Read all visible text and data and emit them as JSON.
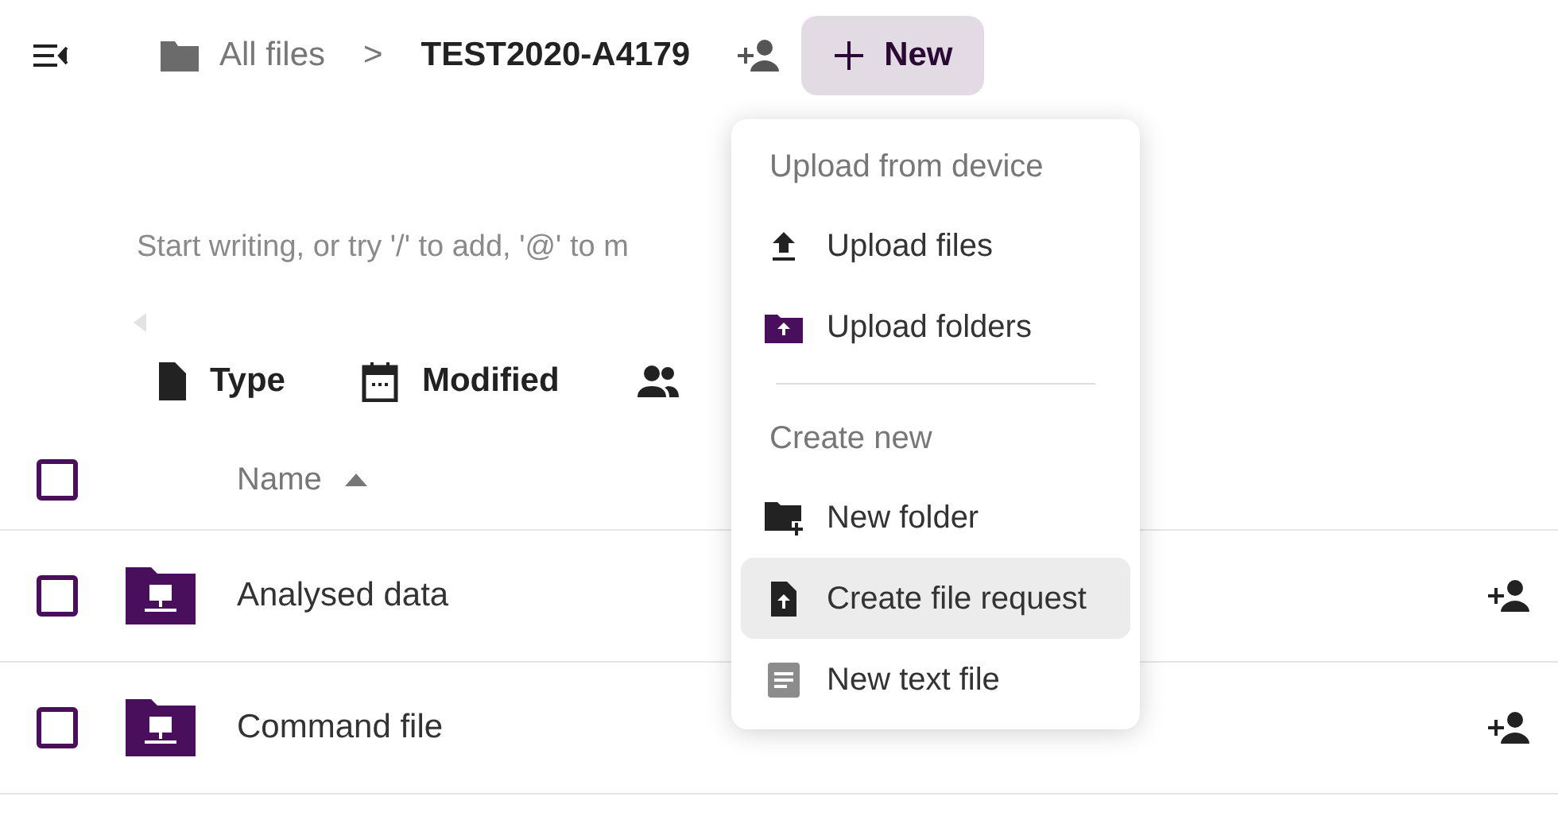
{
  "breadcrumb": {
    "root": "All files",
    "separator": ">",
    "current": "TEST2020-A4179"
  },
  "new_button": {
    "label": "New"
  },
  "editor": {
    "placeholder": "Start writing, or try '/' to add, '@' to m"
  },
  "filters": [
    {
      "label": "Type"
    },
    {
      "label": "Modified"
    }
  ],
  "table": {
    "select_all": {
      "checked": false
    },
    "columns": [
      {
        "label": "Name",
        "sort_ascending": true
      }
    ],
    "rows": [
      {
        "name": "Analysed data",
        "checked": false
      },
      {
        "name": "Command file",
        "checked": false
      }
    ]
  },
  "menu": {
    "items": [
      {
        "kind": "header",
        "label": "Upload from device"
      },
      {
        "kind": "item",
        "label": "Upload files",
        "selected": false
      },
      {
        "kind": "item",
        "label": "Upload folders",
        "selected": false
      },
      {
        "kind": "divider"
      },
      {
        "kind": "header",
        "label": "Create new"
      },
      {
        "kind": "item",
        "label": "New folder",
        "selected": false
      },
      {
        "kind": "item",
        "label": "Create file request",
        "selected": true
      },
      {
        "kind": "item",
        "label": "New text file",
        "selected": false
      }
    ]
  }
}
